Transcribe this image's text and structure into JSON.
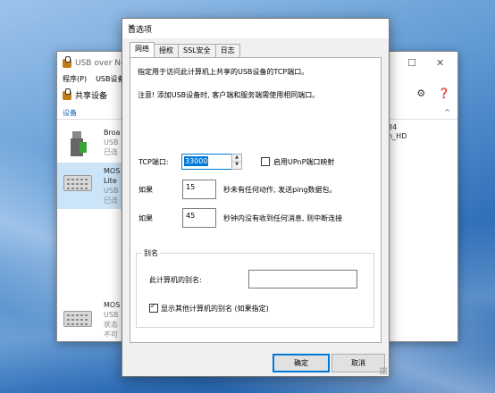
{
  "background_app": {
    "title": "USB over Ne",
    "menu": [
      "程序(P)",
      "USB设备"
    ],
    "toolbar_label": "共享设备",
    "section_label": "设备",
    "devices": [
      {
        "line1": "Broa",
        "line2": "USB",
        "line3": "已连"
      },
      {
        "line1": "MOS",
        "line2": "Lite",
        "line3": "USB",
        "line4": "已连"
      },
      {
        "line1": "MOS",
        "line2": "USB",
        "line3": "状态",
        "line4": "不可"
      }
    ],
    "right_text_1": "34",
    "right_text_2": "n_HD"
  },
  "dialog": {
    "title": "首选项",
    "tabs": [
      "网络",
      "授权",
      "SSL安全",
      "日志"
    ],
    "active_tab": "网络",
    "desc_line": "指定用于访问此计算机上共享的USB设备的TCP端口。",
    "note_line": "注意! 添加USB设备时, 客户端和服务端需使用相同端口。",
    "tcp_port_label": "TCP端口:",
    "tcp_port_value": "33000",
    "upnp_label": "启用UPnP端口映射",
    "upnp_checked": false,
    "idle_prefix": "如果",
    "idle_value": "15",
    "idle_suffix": "秒未有任何动作, 发送ping数据包。",
    "timeout_prefix": "如果",
    "timeout_value": "45",
    "timeout_suffix": "秒钟内没有收到任何消息, 则中断连接",
    "alias_group_label": "别名",
    "alias_label": "此计算机的别名:",
    "alias_value": "",
    "show_alias_label": "显示其他计算机的别名 (如果指定)",
    "show_alias_checked": true,
    "ok_label": "确定",
    "cancel_label": "取消"
  },
  "colors": {
    "accent": "#0078d7",
    "link_blue": "#1a5fb4",
    "desktop": "#2f6fb8"
  }
}
